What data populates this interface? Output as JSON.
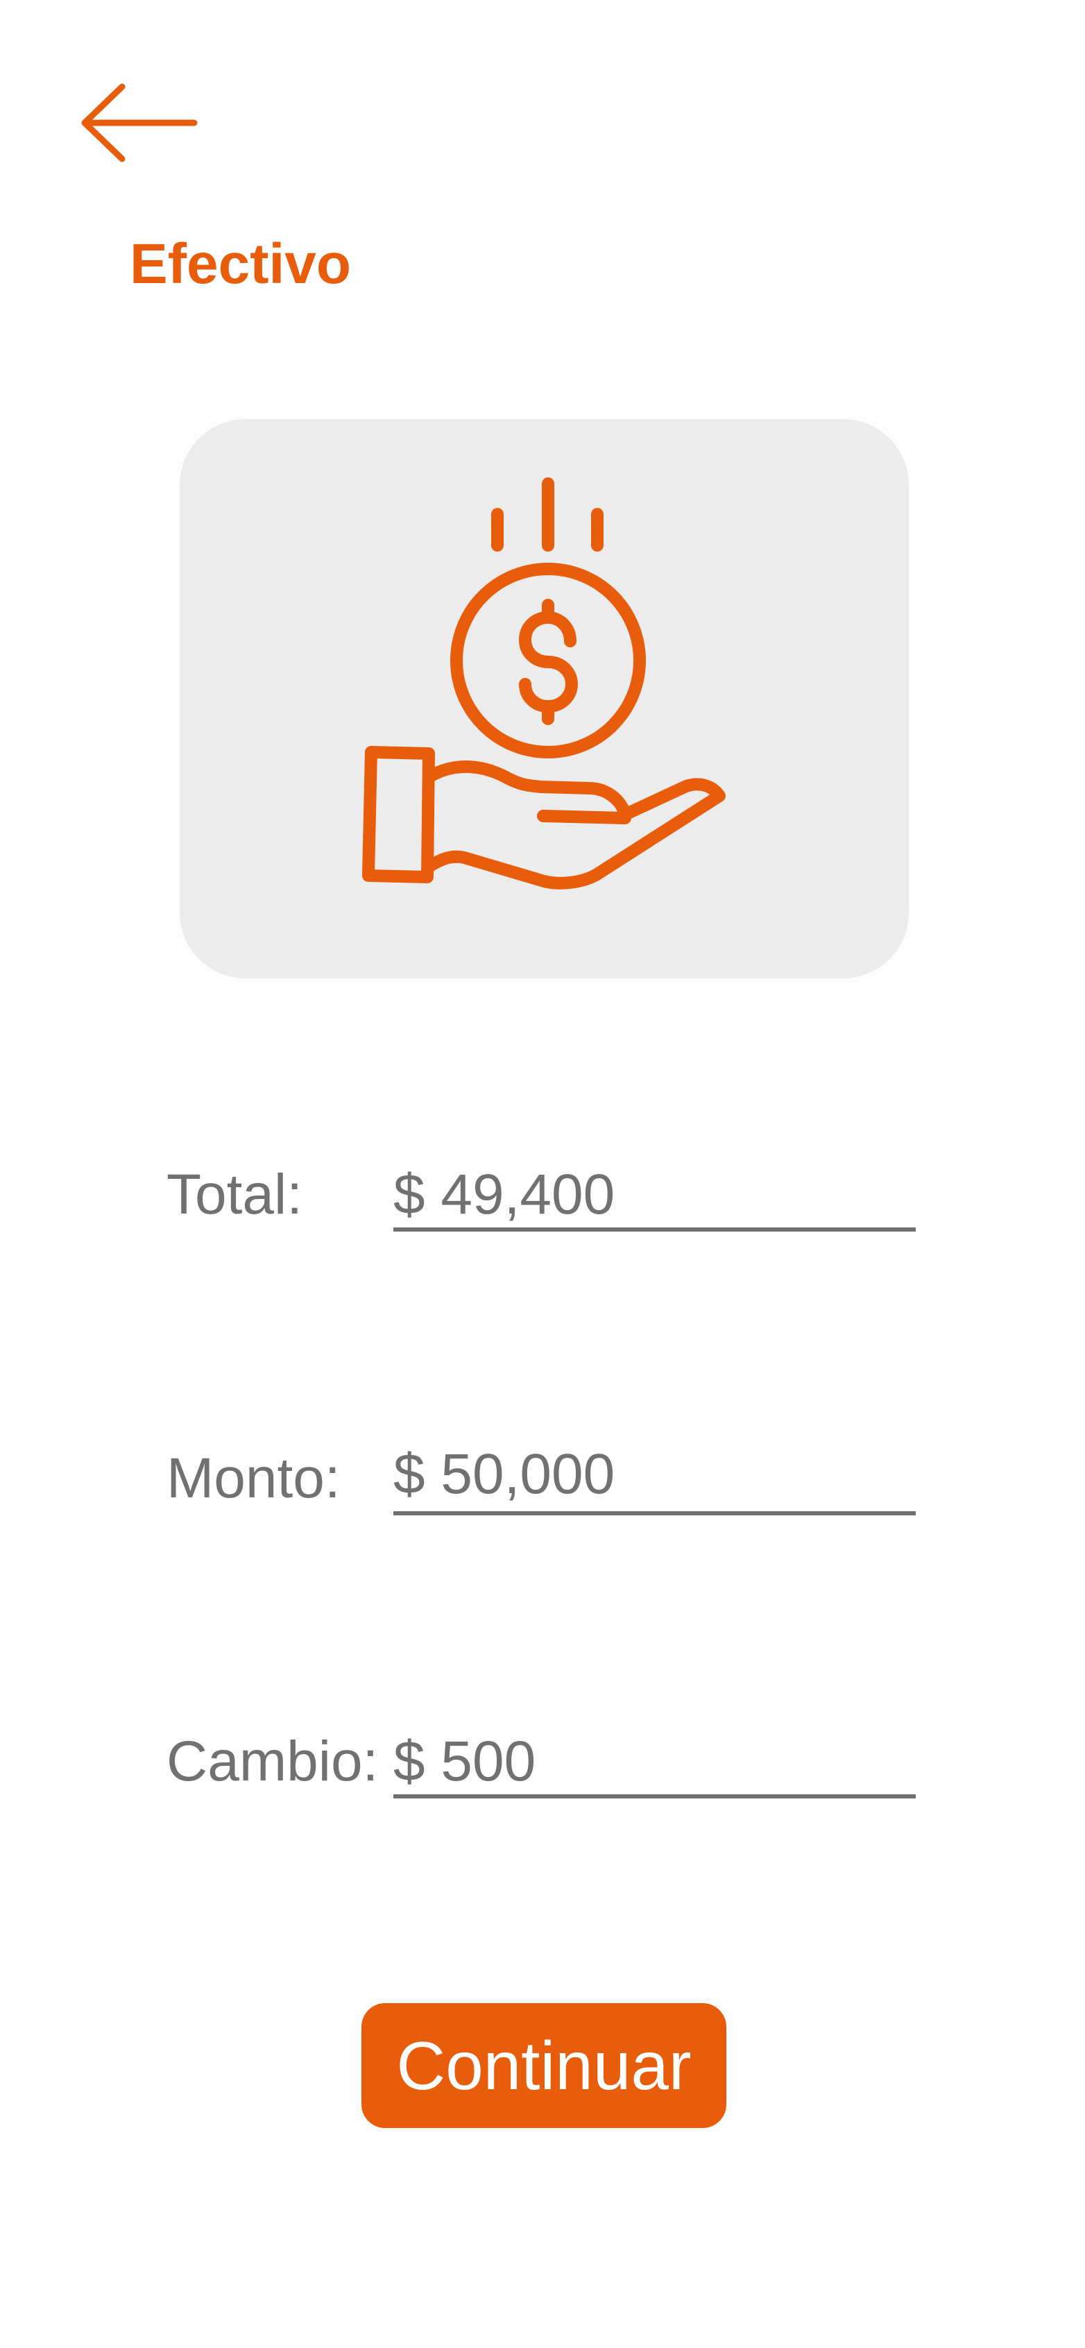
{
  "header": {
    "back_icon": "arrow-left-icon",
    "title": "Efectivo"
  },
  "illustration": {
    "icon": "hand-holding-dollar-coin-icon"
  },
  "fields": {
    "total": {
      "label": "Total:",
      "value": "$ 49,400"
    },
    "monto": {
      "label": "Monto:",
      "value": "$ 50,000"
    },
    "cambio": {
      "label": "Cambio:",
      "value": "$ 500"
    }
  },
  "actions": {
    "continue_label": "Continuar"
  },
  "colors": {
    "accent": "#E85D0C",
    "card_background": "#ECECEC",
    "text_muted": "#717171",
    "page_background": "#FDFDFD"
  }
}
